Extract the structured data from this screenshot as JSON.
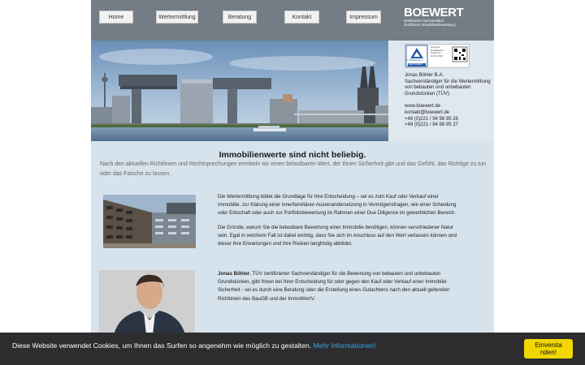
{
  "nav": {
    "items": [
      {
        "label": "Home"
      },
      {
        "label": "Wertermittlung"
      },
      {
        "label": "Beratung"
      },
      {
        "label": "Kontakt"
      },
      {
        "label": "Impressum"
      }
    ]
  },
  "logo": {
    "word_part1": "BOE",
    "word_part2": "WERT",
    "sub_line1": "Zertifizierter Sachverständ",
    "sub_line2": "Zertifizierte Immobilienbewertung |"
  },
  "badge": {
    "tuv_text": "TÜVRheinland",
    "cert_label": "ZERTIFIZIERT",
    "side_text_1": "Geprüfte",
    "side_text_2": "Qualifikation",
    "side_text_3": "Gültig bis",
    "side_text_4": "30.06.2022"
  },
  "info": {
    "name": "Jonas Böhler B.A.",
    "role1": "Sachverständiger für die Wertermittlung",
    "role2": "von bebauten und unbebauten",
    "role3": "Grundstücken (TÜV)",
    "web": "www.boewert.de",
    "email": "kontakt@boewert.de",
    "phone1": "+49 (0)221 / 94 98 95 26",
    "phone2": "+49 (0)221 / 94 98 95 27"
  },
  "content": {
    "headline": "Immobilienwerte sind nicht beliebig.",
    "lead": "Nach den aktuellen Richtlinien und Rechtsprechungen ermitteln wir einen belastbaren Wert, der Ihnen Sicherheit gibt und das Gefühl, das Richtige zu tun oder das Falsche zu lassen.",
    "para1": "Die Wertermittlung bildet die Grundlage für Ihre Entscheidung – sei es zum Kauf oder Verkauf einer Immobilie, zur Klärung einer innerfamiliären Auseinandersetzung in Vermögensfragen, wie einer Scheidung oder Erbschaft oder auch zur Portfoliobewertung im Rahmen einer Due Diligence im gewerblichen Bereich.",
    "para2": "Die Gründe, warum Sie die belastbare Bewertung einer Immobilie benötigen, können verschiedener Natur sein. Egal in welchem Fall ist dabei wichtig, dass Sie sich im Anschluss auf den Wert verlassen können und dieser Ihre Erwartungen und Ihre Risiken langfristig abbildet.",
    "para3_name": "Jonas Böhler",
    "para3": ", TÜV zertifizierter Sachverständiger für die Bewertung von bebauten und unbebauten Grundstücken, gibt Ihnen bei Ihrer Entscheidung für oder gegen den Kauf oder Verkauf einer Immobilie Sicherheit - sei es durch eine Beratung oder die Erstellung eines Gutachtens nach den aktuell geltenden Richtlinien des BauGB und der ImmoWertV."
  },
  "cookie": {
    "text": "Diese Website verwendet Cookies, um Ihnen das Surfen so angenehm wie möglich zu gestalten.",
    "link": "Mehr Informationen!",
    "button_line1": "Einversta",
    "button_line2": "nden!"
  },
  "colors": {
    "topbar": "#747c86",
    "content_bg": "#d6e2ec",
    "cookie_bar": "#2d2d2f",
    "cookie_button": "#f1d600",
    "cookie_link": "#31a8f0"
  }
}
